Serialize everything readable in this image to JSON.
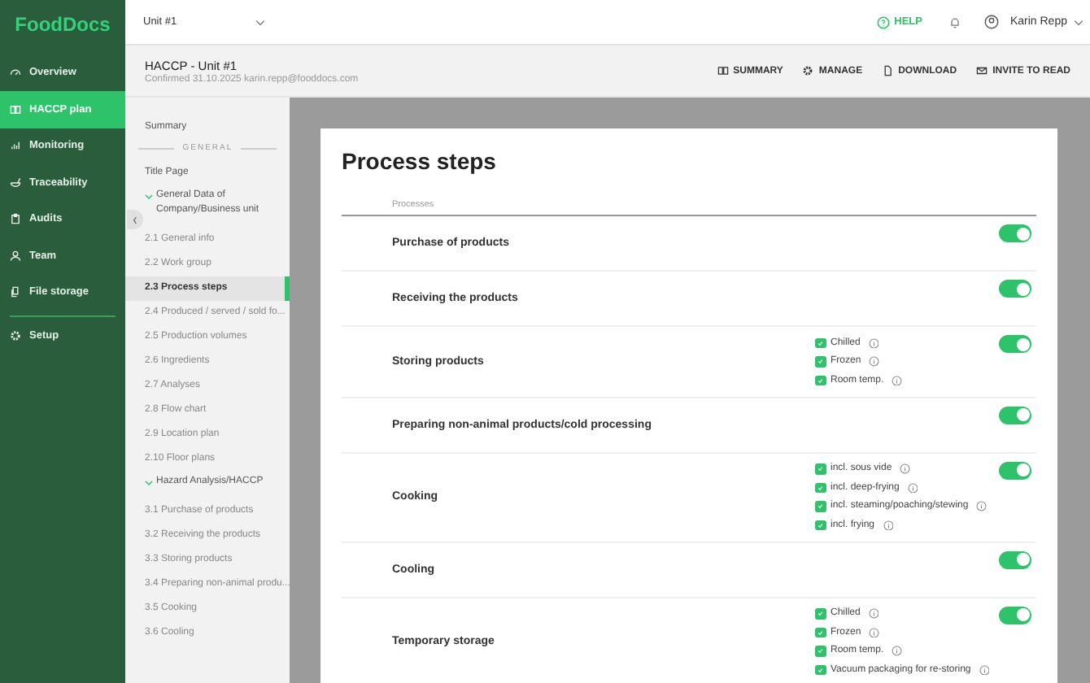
{
  "logo": "FoodDocs",
  "sidebar": {
    "items": [
      {
        "label": "Overview",
        "selected": false
      },
      {
        "label": "HACCP plan",
        "selected": true
      },
      {
        "label": "Monitoring",
        "selected": false
      },
      {
        "label": "Traceability",
        "selected": false
      },
      {
        "label": "Audits",
        "selected": false
      },
      {
        "label": "Team",
        "selected": false
      },
      {
        "label": "File storage",
        "selected": false
      }
    ],
    "bottom_items": [
      {
        "label": "Setup",
        "selected": false
      }
    ]
  },
  "topbar": {
    "unit_select": "Unit #1",
    "help": "HELP",
    "user": "Karin Repp"
  },
  "header": {
    "title": "HACCP - Unit #1",
    "subtitle": "Confirmed 31.10.2025 karin.repp@fooddocs.com",
    "actions": [
      {
        "label": "SUMMARY"
      },
      {
        "label": "MANAGE"
      },
      {
        "label": "DOWNLOAD"
      },
      {
        "label": "INVITE TO READ"
      }
    ]
  },
  "toc": {
    "items": [
      {
        "kind": "item",
        "label": "Summary",
        "selected": false
      },
      {
        "kind": "section",
        "label": "GENERAL"
      },
      {
        "kind": "item",
        "label": "Title Page",
        "selected": false
      },
      {
        "kind": "group",
        "label": "General Data of Company/Business unit",
        "expanded": true,
        "children": [
          {
            "label": "2.1 General info",
            "selected": false
          },
          {
            "label": "2.2 Work group",
            "selected": false
          },
          {
            "label": "2.3 Process steps",
            "selected": true
          },
          {
            "label": "2.4 Produced / served / sold fo...",
            "selected": false
          },
          {
            "label": "2.5 Production volumes",
            "selected": false
          },
          {
            "label": "2.6 Ingredients",
            "selected": false
          },
          {
            "label": "2.7 Analyses",
            "selected": false
          },
          {
            "label": "2.8 Flow chart",
            "selected": false
          },
          {
            "label": "2.9 Location plan",
            "selected": false
          },
          {
            "label": "2.10 Floor plans",
            "selected": false
          }
        ]
      },
      {
        "kind": "group",
        "label": "Hazard Analysis/HACCP",
        "expanded": true,
        "children": [
          {
            "label": "3.1 Purchase of products",
            "selected": false
          },
          {
            "label": "3.2 Receiving the products",
            "selected": false
          },
          {
            "label": "3.3 Storing products",
            "selected": false
          },
          {
            "label": "3.4 Preparing non-animal produ...",
            "selected": false
          },
          {
            "label": "3.5 Cooking",
            "selected": false
          },
          {
            "label": "3.6 Cooling",
            "selected": false
          }
        ]
      }
    ]
  },
  "page": {
    "title": "Process steps",
    "column": "Processes",
    "rows": [
      {
        "name": "Purchase of products",
        "on": true,
        "options": []
      },
      {
        "name": "Receiving the products",
        "on": true,
        "options": []
      },
      {
        "name": "Storing products",
        "on": true,
        "options": [
          {
            "label": "Chilled",
            "checked": true
          },
          {
            "label": "Frozen",
            "checked": true
          },
          {
            "label": "Room temp.",
            "checked": true
          }
        ]
      },
      {
        "name": "Preparing non-animal products/cold processing",
        "on": true,
        "options": []
      },
      {
        "name": "Cooking",
        "on": true,
        "options": [
          {
            "label": "incl. sous vide",
            "checked": true
          },
          {
            "label": "incl. deep-frying",
            "checked": true
          },
          {
            "label": "incl. steaming/poaching/stewing",
            "checked": true
          },
          {
            "label": "incl. frying",
            "checked": true
          }
        ]
      },
      {
        "name": "Cooling",
        "on": true,
        "options": []
      },
      {
        "name": "Temporary storage",
        "on": true,
        "options": [
          {
            "label": "Chilled",
            "checked": true
          },
          {
            "label": "Frozen",
            "checked": true
          },
          {
            "label": "Room temp.",
            "checked": true
          },
          {
            "label": "Vacuum packaging for re-storing",
            "checked": true
          }
        ]
      }
    ]
  }
}
